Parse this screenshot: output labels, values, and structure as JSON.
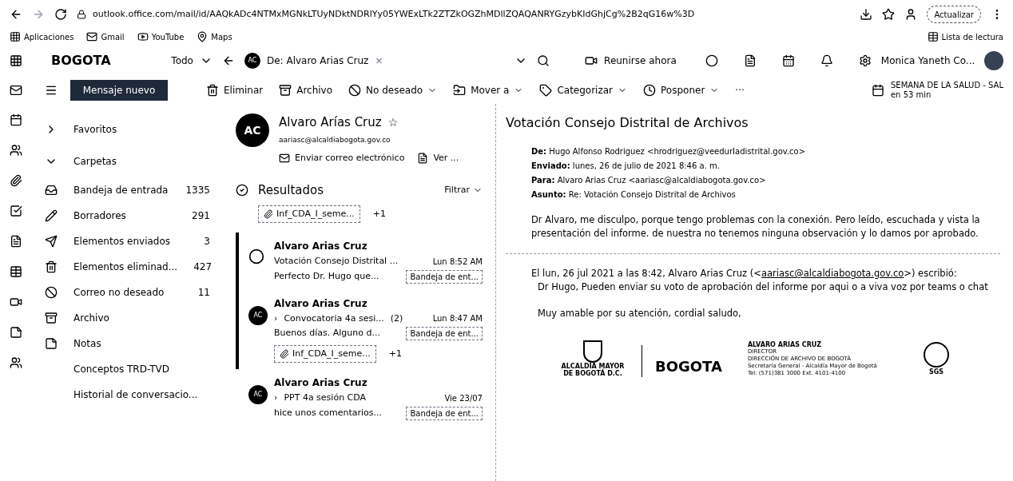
{
  "browser": {
    "url": "outlook.office.com/mail/id/AAQkADc4NTMxMGNkLTUyNDktNDRlYy05YWExLTk2ZTZkOGZhMDllZQAQANRYGzybKIdGhjCg%2B2qG16w%3D",
    "update_button": "Actualizar",
    "bookmarks": [
      {
        "label": "Aplicaciones",
        "kind": "apps"
      },
      {
        "label": "Gmail",
        "kind": "mail"
      },
      {
        "label": "YouTube",
        "kind": "video"
      },
      {
        "label": "Maps",
        "kind": "map"
      }
    ],
    "reading_list": "Lista de lectura"
  },
  "header": {
    "logo": "BOGOTA",
    "scope": "Todo",
    "search_chip": {
      "avatar": "AC",
      "label": "De: Alvaro Arias Cruz",
      "clear": "×"
    },
    "meet_now": "Reunirse ahora",
    "user": "Monica Yaneth Co..."
  },
  "toolbar": {
    "new_message": "Mensaje nuevo",
    "actions": [
      {
        "label": "Eliminar",
        "kind": "delete",
        "dropdown": false
      },
      {
        "label": "Archivo",
        "kind": "archive",
        "dropdown": false
      },
      {
        "label": "No deseado",
        "kind": "junk",
        "dropdown": true
      },
      {
        "label": "Mover a",
        "kind": "move",
        "dropdown": true
      },
      {
        "label": "Categorizar",
        "kind": "tag",
        "dropdown": true
      },
      {
        "label": "Posponer",
        "kind": "snooze",
        "dropdown": true
      }
    ],
    "more": "···",
    "reminder": {
      "title": "SEMANA DE LA SALUD - SAL",
      "time": "en 53 min"
    }
  },
  "folders": {
    "sections": [
      {
        "label": "Favoritos",
        "expanded": false
      },
      {
        "label": "Carpetas",
        "expanded": true
      }
    ],
    "items": [
      {
        "label": "Bandeja de entrada",
        "count": "1335",
        "kind": "inbox"
      },
      {
        "label": "Borradores",
        "count": "291",
        "kind": "drafts"
      },
      {
        "label": "Elementos enviados",
        "count": "3",
        "kind": "sent"
      },
      {
        "label": "Elementos eliminad...",
        "count": "427",
        "kind": "deleted"
      },
      {
        "label": "Correo no deseado",
        "count": "11",
        "kind": "junk"
      },
      {
        "label": "Archivo",
        "kind": "archive"
      },
      {
        "label": "Notas",
        "kind": "notes"
      },
      {
        "label": "Conceptos TRD-TVD",
        "kind": "plain"
      },
      {
        "label": "Historial de conversacio...",
        "kind": "plain"
      }
    ]
  },
  "contact": {
    "avatar": "AC",
    "name": "Alvaro Arías Cruz",
    "star": "☆",
    "email": "aariasc@alcaldiabogota.gov.co",
    "send_email": "Enviar correo electrónico",
    "view": "Ver ..."
  },
  "results": {
    "title": "Resultados",
    "filter": "Filtrar",
    "attachment": {
      "name": "Inf_CDA_I_seme...",
      "more": "+1"
    },
    "messages": [
      {
        "sender": "Alvaro Arias Cruz",
        "subject": "Votación Consejo Distrital ...",
        "time": "Lun 8:52 AM",
        "preview": "Perfecto Dr. Hugo que...",
        "folder": "Bandeja de ent...",
        "highlighted": true
      },
      {
        "avatar": "AC",
        "sender": "Alvaro Arias Cruz",
        "expand": "›",
        "subject": "Convocatoria 4a sesi...",
        "thread_count": "(2)",
        "time": "Lun 8:47 AM",
        "preview": "Buenos días. Alguno d...",
        "folder": "Bandeja de ent...",
        "attachment": {
          "name": "Inf_CDA_I_seme...",
          "more": "+1"
        },
        "highlighted": true
      },
      {
        "avatar": "AC",
        "sender": "Alvaro Arias Cruz",
        "expand": "›",
        "subject": "PPT 4a sesión CDA",
        "time": "Vie 23/07",
        "preview": "hice unos comentarios...",
        "folder": "Bandeja de ent...",
        "highlighted": false
      }
    ]
  },
  "reading": {
    "subject": "Votación Consejo Distrital de Archivos",
    "header_lines": [
      "**De:** Hugo Alfonso Rodriguez <hrodriguez@veedurIadistrital.gov.co>",
      "**Enviado:** lunes, 26 de julio de 2021 8:46 a. m.",
      "**Para:** Alvaro Arias Cruz <aariasc@alcaldiabogota.gov.co>",
      "**Asunto:** Re: Votación Consejo Distrital de Archivos"
    ],
    "body": "Dr Alvaro, me disculpo, porque tengo problemas con la conexión. Pero leído, escuchada y vista  la presentación del informe. de nuestra no tenemos ninguna observación y lo damos por aprobado.",
    "quote_intro": "El lun, 26 jul 2021 a las 8:42, Alvaro Arias Cruz (<",
    "quote_link": "aariasc@alcaldiabogota.gov.co",
    "quote_outro": ">) escribió:",
    "quote_body": "Dr Hugo, Pueden enviar su voto de aprobación del informe por aqui o a viva voz por teams o chat",
    "closing": "Muy amable por su atención, cordial saludo,",
    "signature": {
      "seal_caption": "ALCALDÍA MAYOR DE BOGOTÁ D.C.",
      "logo": "BOGOTA",
      "name": "ALVARO ARIAS CRUZ",
      "lines": [
        "DIRECTOR",
        "DIRECCIÓN DE ARCHIVO DE BOGOTÁ",
        "Secretaría General - Alcaldía Mayor de Bogotá",
        "Tel: (571)381 3000 Ext. 4101-4100"
      ],
      "cert": "SGS"
    }
  }
}
